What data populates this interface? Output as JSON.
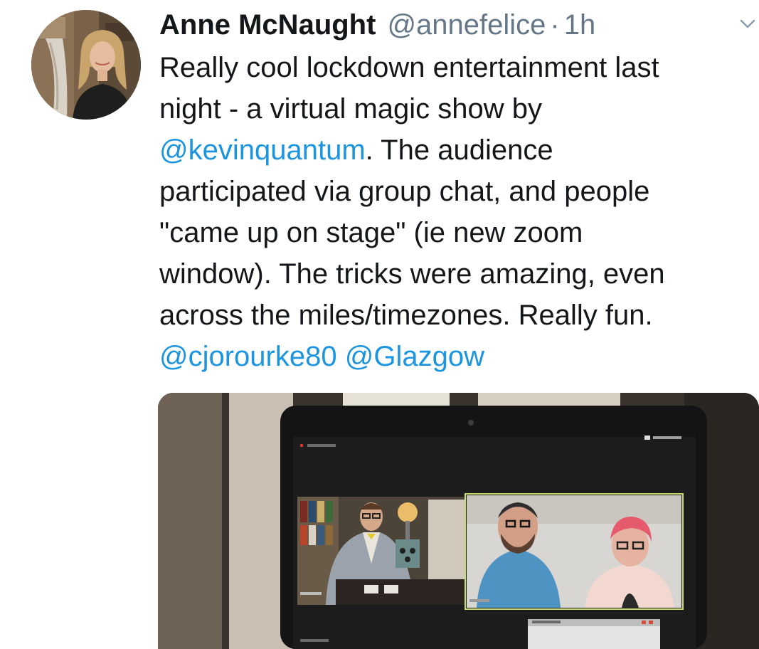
{
  "tweet": {
    "display_name": "Anne McNaught",
    "handle": "@annefelice",
    "separator": "·",
    "time": "1h",
    "text_lines": [
      [
        {
          "t": "Really cool lockdown entertainment last"
        }
      ],
      [
        {
          "t": "night - a virtual magic show by"
        }
      ],
      [
        {
          "t": "@kevinquantum",
          "mention": true
        },
        {
          "t": ". The audience"
        }
      ],
      [
        {
          "t": "participated via group chat, and people"
        }
      ],
      [
        {
          "t": "\"came up on stage\" (ie new zoom"
        }
      ],
      [
        {
          "t": "window). The tricks were amazing, even"
        }
      ],
      [
        {
          "t": "across the miles/timezones. Really fun."
        }
      ],
      [
        {
          "t": "@cjorourke80",
          "mention": true
        },
        {
          "t": " "
        },
        {
          "t": "@Glazgow",
          "mention": true
        }
      ]
    ]
  },
  "icons": {
    "menu": "chevron-down-icon"
  },
  "colors": {
    "text": "#14171a",
    "secondary": "#657786",
    "link": "#1b95e0",
    "zoom_active_border": "#c8d96b"
  }
}
